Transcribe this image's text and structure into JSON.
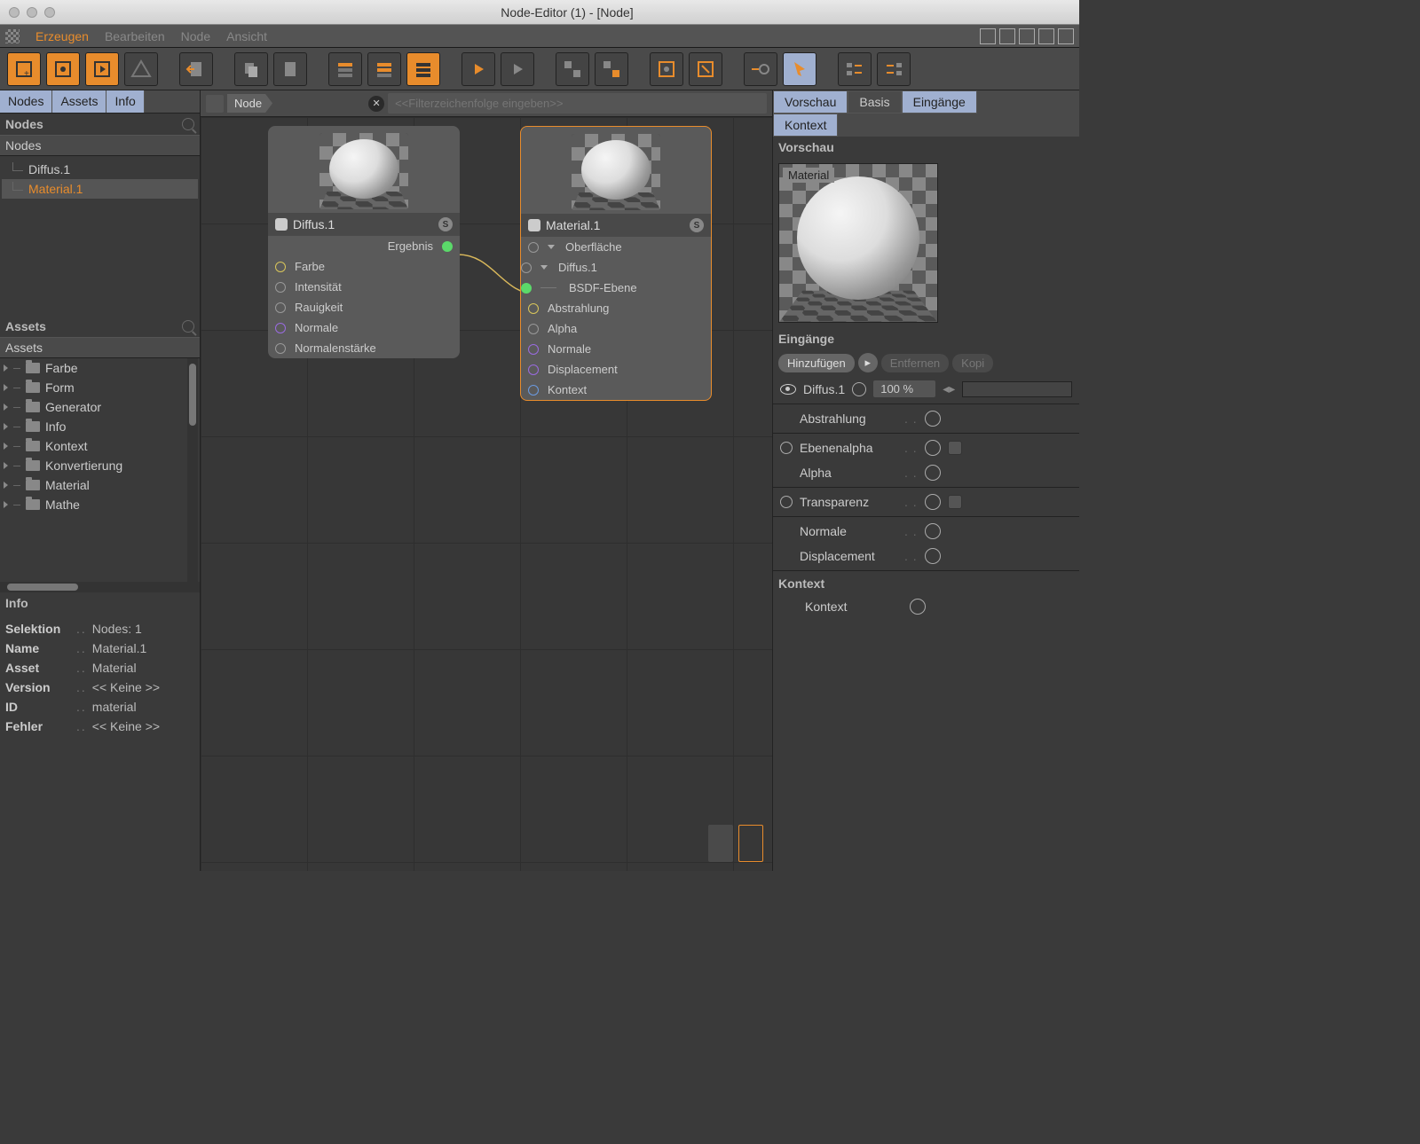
{
  "window": {
    "title": "Node-Editor (1) - [Node]"
  },
  "menubar": {
    "items": [
      "Erzeugen",
      "Bearbeiten",
      "Node",
      "Ansicht"
    ],
    "active": 0
  },
  "left": {
    "tabs": [
      "Nodes",
      "Assets",
      "Info"
    ],
    "nodes_hdr": "Nodes",
    "nodes_list_hdr": "Nodes",
    "tree": [
      {
        "name": "Diffus.1",
        "selected": false
      },
      {
        "name": "Material.1",
        "selected": true
      }
    ],
    "assets_hdr": "Assets",
    "assets_list_hdr": "Assets",
    "asset_items": [
      "Farbe",
      "Form",
      "Generator",
      "Info",
      "Kontext",
      "Konvertierung",
      "Material",
      "Mathe"
    ],
    "info_hdr": "Info",
    "info_rows": [
      {
        "k": "Selektion",
        "v": "Nodes: 1"
      },
      {
        "k": "Name",
        "v": "Material.1"
      },
      {
        "k": "Asset",
        "v": "Material"
      },
      {
        "k": "Version",
        "v": "<< Keine >>"
      },
      {
        "k": "ID",
        "v": "material"
      },
      {
        "k": "Fehler",
        "v": "<< Keine >>"
      }
    ]
  },
  "breadcrumb": {
    "item": "Node",
    "filter_placeholder": "<<Filterzeichenfolge eingeben>>"
  },
  "nodes_canvas": {
    "diffus": {
      "title": "Diffus.1",
      "out": "Ergebnis",
      "ins": [
        "Farbe",
        "Intensität",
        "Rauigkeit",
        "Normale",
        "Normalenstärke"
      ]
    },
    "material": {
      "title": "Material.1",
      "groups": {
        "g1": "Oberfläche",
        "g1a": "Diffus.1",
        "g1b": "BSDF-Ebene"
      },
      "ins": [
        "Abstrahlung",
        "Alpha",
        "Normale",
        "Displacement",
        "Kontext"
      ]
    }
  },
  "right": {
    "tabs_row1": [
      "Vorschau",
      "Basis",
      "Eingänge"
    ],
    "tabs_row2": [
      "Kontext"
    ],
    "preview_hdr": "Vorschau",
    "preview_label": "Material",
    "inputs_hdr": "Eingänge",
    "btn_add": "Hinzufügen",
    "btn_remove": "Entfernen",
    "btn_copy": "Kopi",
    "diffus_row": {
      "name": "Diffus.1",
      "value": "100 %"
    },
    "props": [
      {
        "label": "Abstrahlung"
      },
      {
        "label": "Ebenenalpha",
        "radio": true,
        "chk": true
      },
      {
        "label": "Alpha"
      },
      {
        "label": "Transparenz",
        "radio": true,
        "chk": true
      },
      {
        "label": "Normale"
      },
      {
        "label": "Displacement"
      }
    ],
    "kontext_hdr": "Kontext",
    "kontext_label": "Kontext"
  }
}
